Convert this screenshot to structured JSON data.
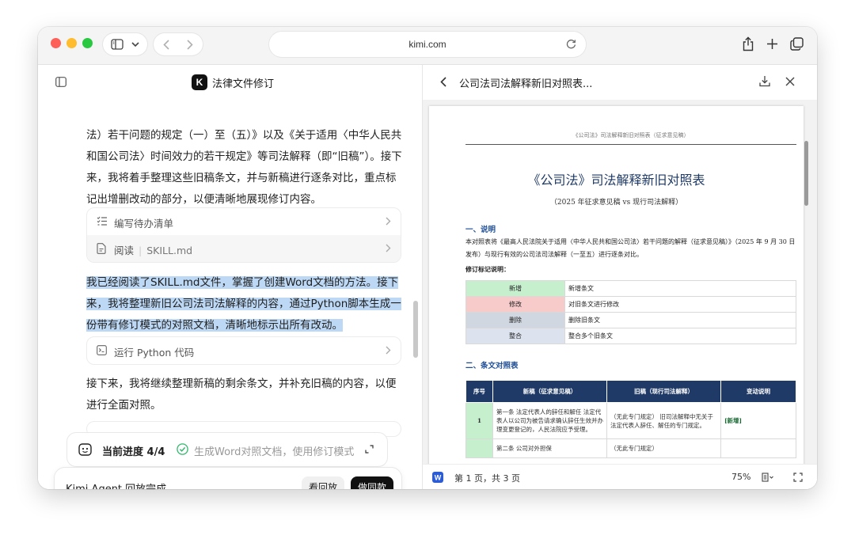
{
  "browser": {
    "url": "kimi.com"
  },
  "chat": {
    "title": "法律文件修订",
    "logo_letter": "K",
    "para1": "法）若干问题的规定（一）至（五）》以及《关于适用〈中华人民共和国公司法〉时间效力的若干规定》等司法解释（即“旧稿”）。接下来，我将着手整理这些旧稿条文，并与新稿进行逐条对比，重点标记出增删改动的部分，以便清晰地展现修订内容。",
    "tools1": [
      {
        "label": "编写待办清单",
        "icon": "checklist-icon"
      },
      {
        "label": "阅读",
        "file": "SKILL.md",
        "icon": "file-icon"
      }
    ],
    "para2": "我已经阅读了SKILL.md文件，掌握了创建Word文档的方法。接下来，我将整理新旧公司法司法解释的内容，通过Python脚本生成一份带有修订模式的对照文档，清晰地标示出所有改动。",
    "tool2": {
      "label": "运行 Python 代码",
      "icon": "terminal-icon"
    },
    "para3": "接下来，我将继续整理新稿的剩余条文，并补充旧稿的内容，以便进行全面对照。",
    "progress": {
      "label": "当前进度 4/4",
      "task": "生成Word对照文档，使用修订模式"
    },
    "agent": {
      "status": "Kimi Agent 回放完成",
      "replay_button": "看回放",
      "same_button": "做同款"
    }
  },
  "document": {
    "tab_title": "公司法司法解释新旧对照表...",
    "page_header": "《公司法》司法解释新旧对照表（征求意见稿）",
    "heading": "《公司法》司法解释新旧对照表",
    "subtitle": "（2025 年征求意见稿 vs 现行司法解释）",
    "section1": "一、说明",
    "intro": "本对照表将《最高人民法院关于适用〈中华人民共和国公司法〉若干问题的解释（征求意见稿）》（2025 年 9 月 30 日发布）与现行有效的公司法司法解释（一至五）进行逐条对比。",
    "legend_title": "修订标记说明：",
    "legend": [
      {
        "key": "新增",
        "desc": "新增条文",
        "color": "#c6efce"
      },
      {
        "key": "修改",
        "desc": "对旧条文进行修改",
        "color": "#f8cbcb"
      },
      {
        "key": "删除",
        "desc": "删除旧条文",
        "color": "#d0d7e1"
      },
      {
        "key": "整合",
        "desc": "整合多个旧条文",
        "color": "#dce3ef"
      }
    ],
    "section2": "二、条文对照表",
    "table": {
      "headers": [
        "序号",
        "新稿（征求意见稿）",
        "旧稿（现行司法解释）",
        "变动说明"
      ],
      "rows": [
        {
          "no": "1",
          "new": "第一条 法定代表人的辞任和解任 法定代表人以公司为被告请求确认辞任生效并办理变更登记的，人民法院应予受理。",
          "old": "（无此专门规定） 旧司法解释中无关于法定代表人辞任、解任的专门规定。",
          "change": "[新增]"
        },
        {
          "no": "",
          "new": "第二条 公司对外担保",
          "old": "（无此专门规定）",
          "change": ""
        }
      ]
    },
    "status": {
      "page": "第 1 页，共 3 页",
      "zoom": "75%"
    }
  }
}
